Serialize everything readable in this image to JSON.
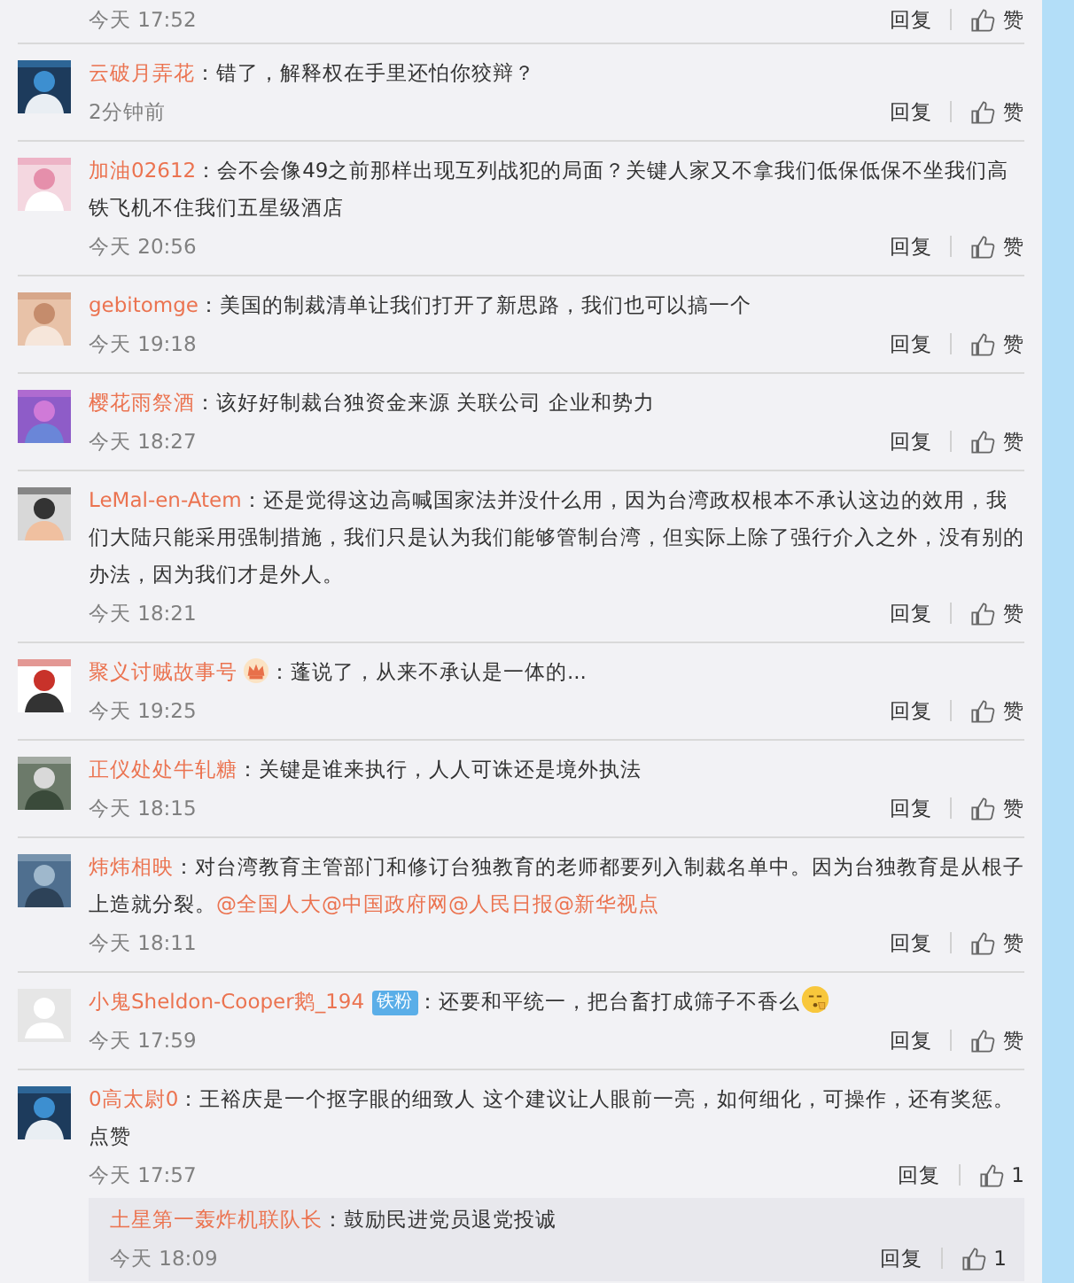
{
  "top_partial": {
    "time": "今天 17:52",
    "reply": "回复",
    "like": "赞"
  },
  "comments": [
    {
      "user": "云破月弄花",
      "text": "：错了，解释权在手里还怕你狡辩？",
      "time": "2分钟前",
      "reply": "回复",
      "like": "赞"
    },
    {
      "user": "加油02612",
      "text": "：会不会像49之前那样出现互列战犯的局面？关键人家又不拿我们低保低保不坐我们高铁飞机不住我们五星级酒店",
      "time": "今天 20:56",
      "reply": "回复",
      "like": "赞"
    },
    {
      "user": "gebitomge",
      "text": "：美国的制裁清单让我们打开了新思路，我们也可以搞一个",
      "time": "今天 19:18",
      "reply": "回复",
      "like": "赞"
    },
    {
      "user": "樱花雨祭酒",
      "text": "：该好好制裁台独资金来源 关联公司 企业和势力",
      "time": "今天 18:27",
      "reply": "回复",
      "like": "赞"
    },
    {
      "user": "LeMal-en-Atem",
      "text": "：还是觉得这边高喊国家法并没什么用，因为台湾政权根本不承认这边的效用，我们大陆只能采用强制措施，我们只是认为我们能够管制台湾，但实际上除了强行介入之外，没有别的办法，因为我们才是外人。",
      "time": "今天 18:21",
      "reply": "回复",
      "like": "赞"
    },
    {
      "user": "聚义讨贼故事号",
      "badge": {
        "kind": "crown"
      },
      "text": "：蓬说了，从来不承认是一体的...",
      "time": "今天 19:25",
      "reply": "回复",
      "like": "赞"
    },
    {
      "user": "正仪处处牛轧糖",
      "text": "：关键是谁来执行，人人可诛还是境外执法",
      "time": "今天 18:15",
      "reply": "回复",
      "like": "赞"
    },
    {
      "user": "炜炜相映",
      "text": "：对台湾教育主管部门和修订台独教育的老师都要列入制裁名单中。因为台独教育是从根子上造就分裂。",
      "links": [
        "@全国人大",
        "@中国政府网",
        "@人民日报",
        "@新华视点"
      ],
      "time": "今天 18:11",
      "reply": "回复",
      "like": "赞"
    },
    {
      "user": "小鬼Sheldon-Cooper鹅_194",
      "default_avatar": true,
      "badge": {
        "kind": "label",
        "text": "铁粉"
      },
      "text": "：还要和平统一，把台畜打成筛子不香么",
      "emoji": true,
      "time": "今天 17:59",
      "reply": "回复",
      "like": "赞"
    },
    {
      "user": "0高太尉0",
      "text": "：王裕庆是一个抠字眼的细致人 这个建议让人眼前一亮，如何细化，可操作，还有奖惩。点赞",
      "time": "今天 17:57",
      "reply": "回复",
      "like": "1",
      "replies": [
        {
          "user": "土星第一轰炸机联队长",
          "text": "：鼓励民进党员退党投诚",
          "time": "今天 18:09",
          "reply": "回复",
          "like": "1"
        }
      ]
    }
  ]
}
